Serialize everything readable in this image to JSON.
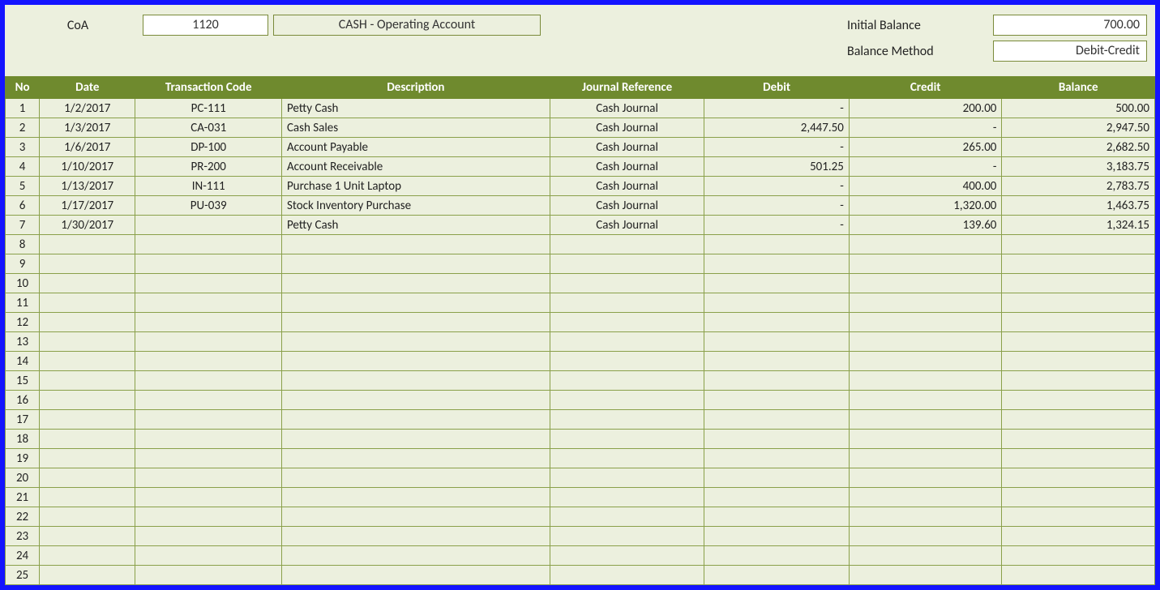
{
  "header": {
    "coa_label": "CoA",
    "coa_value": "1120",
    "account_name": "CASH - Operating Account",
    "initial_balance_label": "Initial Balance",
    "initial_balance_value": "700.00",
    "balance_method_label": "Balance Method",
    "balance_method_value": "Debit-Credit"
  },
  "columns": {
    "no": "No",
    "date": "Date",
    "code": "Transaction Code",
    "desc": "Description",
    "jref": "Journal Reference",
    "debit": "Debit",
    "credit": "Credit",
    "balance": "Balance"
  },
  "rows": [
    {
      "no": "1",
      "date": "1/2/2017",
      "code": "PC-111",
      "desc": "Petty Cash",
      "jref": "Cash Journal",
      "debit": "-",
      "credit": "200.00",
      "balance": "500.00"
    },
    {
      "no": "2",
      "date": "1/3/2017",
      "code": "CA-031",
      "desc": "Cash Sales",
      "jref": "Cash Journal",
      "debit": "2,447.50",
      "credit": "-",
      "balance": "2,947.50"
    },
    {
      "no": "3",
      "date": "1/6/2017",
      "code": "DP-100",
      "desc": "Account Payable",
      "jref": "Cash Journal",
      "debit": "-",
      "credit": "265.00",
      "balance": "2,682.50"
    },
    {
      "no": "4",
      "date": "1/10/2017",
      "code": "PR-200",
      "desc": "Account Receivable",
      "jref": "Cash Journal",
      "debit": "501.25",
      "credit": "-",
      "balance": "3,183.75"
    },
    {
      "no": "5",
      "date": "1/13/2017",
      "code": "IN-111",
      "desc": "Purchase 1 Unit Laptop",
      "jref": "Cash Journal",
      "debit": "-",
      "credit": "400.00",
      "balance": "2,783.75"
    },
    {
      "no": "6",
      "date": "1/17/2017",
      "code": "PU-039",
      "desc": "Stock Inventory Purchase",
      "jref": "Cash Journal",
      "debit": "-",
      "credit": "1,320.00",
      "balance": "1,463.75"
    },
    {
      "no": "7",
      "date": "1/30/2017",
      "code": "",
      "desc": "Petty Cash",
      "jref": "Cash Journal",
      "debit": "-",
      "credit": "139.60",
      "balance": "1,324.15"
    },
    {
      "no": "8",
      "date": "",
      "code": "",
      "desc": "",
      "jref": "",
      "debit": "",
      "credit": "",
      "balance": ""
    },
    {
      "no": "9",
      "date": "",
      "code": "",
      "desc": "",
      "jref": "",
      "debit": "",
      "credit": "",
      "balance": ""
    },
    {
      "no": "10",
      "date": "",
      "code": "",
      "desc": "",
      "jref": "",
      "debit": "",
      "credit": "",
      "balance": ""
    },
    {
      "no": "11",
      "date": "",
      "code": "",
      "desc": "",
      "jref": "",
      "debit": "",
      "credit": "",
      "balance": ""
    },
    {
      "no": "12",
      "date": "",
      "code": "",
      "desc": "",
      "jref": "",
      "debit": "",
      "credit": "",
      "balance": ""
    },
    {
      "no": "13",
      "date": "",
      "code": "",
      "desc": "",
      "jref": "",
      "debit": "",
      "credit": "",
      "balance": ""
    },
    {
      "no": "14",
      "date": "",
      "code": "",
      "desc": "",
      "jref": "",
      "debit": "",
      "credit": "",
      "balance": ""
    },
    {
      "no": "15",
      "date": "",
      "code": "",
      "desc": "",
      "jref": "",
      "debit": "",
      "credit": "",
      "balance": ""
    },
    {
      "no": "16",
      "date": "",
      "code": "",
      "desc": "",
      "jref": "",
      "debit": "",
      "credit": "",
      "balance": ""
    },
    {
      "no": "17",
      "date": "",
      "code": "",
      "desc": "",
      "jref": "",
      "debit": "",
      "credit": "",
      "balance": ""
    },
    {
      "no": "18",
      "date": "",
      "code": "",
      "desc": "",
      "jref": "",
      "debit": "",
      "credit": "",
      "balance": ""
    },
    {
      "no": "19",
      "date": "",
      "code": "",
      "desc": "",
      "jref": "",
      "debit": "",
      "credit": "",
      "balance": ""
    },
    {
      "no": "20",
      "date": "",
      "code": "",
      "desc": "",
      "jref": "",
      "debit": "",
      "credit": "",
      "balance": ""
    },
    {
      "no": "21",
      "date": "",
      "code": "",
      "desc": "",
      "jref": "",
      "debit": "",
      "credit": "",
      "balance": ""
    },
    {
      "no": "22",
      "date": "",
      "code": "",
      "desc": "",
      "jref": "",
      "debit": "",
      "credit": "",
      "balance": ""
    },
    {
      "no": "23",
      "date": "",
      "code": "",
      "desc": "",
      "jref": "",
      "debit": "",
      "credit": "",
      "balance": ""
    },
    {
      "no": "24",
      "date": "",
      "code": "",
      "desc": "",
      "jref": "",
      "debit": "",
      "credit": "",
      "balance": ""
    },
    {
      "no": "25",
      "date": "",
      "code": "",
      "desc": "",
      "jref": "",
      "debit": "",
      "credit": "",
      "balance": ""
    }
  ]
}
